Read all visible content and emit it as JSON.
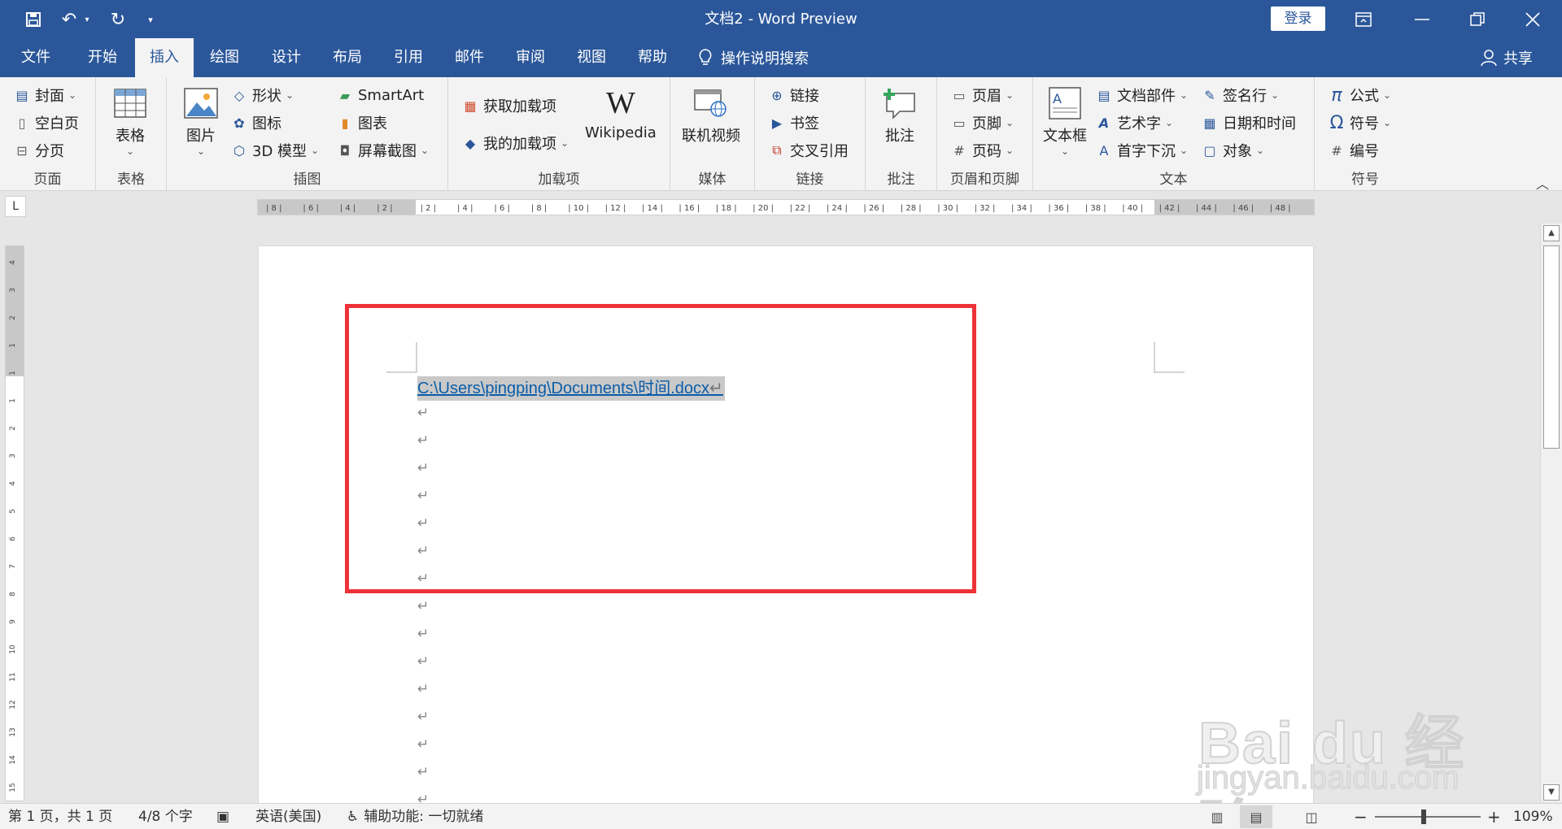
{
  "window": {
    "title": "文档2  -  Word Preview",
    "login_label": "登录",
    "undo_caret": "▾",
    "qat_caret": "▾"
  },
  "tabs": [
    {
      "label": "文件"
    },
    {
      "label": "开始"
    },
    {
      "label": "插入"
    },
    {
      "label": "绘图"
    },
    {
      "label": "设计"
    },
    {
      "label": "布局"
    },
    {
      "label": "引用"
    },
    {
      "label": "邮件"
    },
    {
      "label": "审阅"
    },
    {
      "label": "视图"
    },
    {
      "label": "帮助"
    }
  ],
  "tell_me": "操作说明搜索",
  "share_label": "共享",
  "ribbon": {
    "pages": {
      "cover": "封面",
      "blank": "空白页",
      "break": "分页",
      "label": "页面"
    },
    "tables": {
      "table": "表格",
      "label": "表格"
    },
    "illustrations": {
      "pictures": "图片",
      "shapes": "形状",
      "icons": "图标",
      "model3d": "3D 模型",
      "smartart": "SmartArt",
      "chart": "图表",
      "screenshot": "屏幕截图",
      "label": "插图"
    },
    "addins": {
      "get": "获取加载项",
      "mine": "我的加载项",
      "wikipedia": "Wikipedia",
      "label": "加载项"
    },
    "media": {
      "video": "联机视频",
      "label": "媒体"
    },
    "links": {
      "link": "链接",
      "bookmark": "书签",
      "crossref": "交叉引用",
      "label": "链接"
    },
    "comments": {
      "comment": "批注",
      "label": "批注"
    },
    "headerfooter": {
      "header": "页眉",
      "footer": "页脚",
      "pagenum": "页码",
      "label": "页眉和页脚"
    },
    "text": {
      "textbox": "文本框",
      "quickparts": "文档部件",
      "wordart": "艺术字",
      "dropcap": "首字下沉",
      "signature": "签名行",
      "datetime": "日期和时间",
      "object": "对象",
      "label": "文本"
    },
    "symbols": {
      "equation": "公式",
      "symbol": "符号",
      "number": "编号",
      "label": "符号"
    }
  },
  "ruler": {
    "h_ticks": [
      "8",
      "6",
      "4",
      "2",
      "2",
      "4",
      "6",
      "8",
      "10",
      "12",
      "14",
      "16",
      "18",
      "20",
      "22",
      "24",
      "26",
      "28",
      "30",
      "32",
      "34",
      "36",
      "38",
      "40",
      "42",
      "44",
      "46",
      "48"
    ],
    "v_ticks": [
      "4",
      "3",
      "2",
      "1",
      "1",
      "1",
      "2",
      "3",
      "4",
      "5",
      "6",
      "7",
      "8",
      "9",
      "10",
      "11",
      "12",
      "13",
      "14",
      "15"
    ],
    "tab_selector": "L"
  },
  "document": {
    "link_text": "C:\\Users\\pingping\\Documents\\时间.docx",
    "pilcrow": "↵"
  },
  "watermark": {
    "brand": "Bai  du 经验",
    "url": "jingyan.baidu.com"
  },
  "status": {
    "page": "第 1 页，共 1 页",
    "words": "4/8 个字",
    "language": "英语(美国)",
    "accessibility": "辅助功能: 一切就绪",
    "zoom": "109%"
  }
}
